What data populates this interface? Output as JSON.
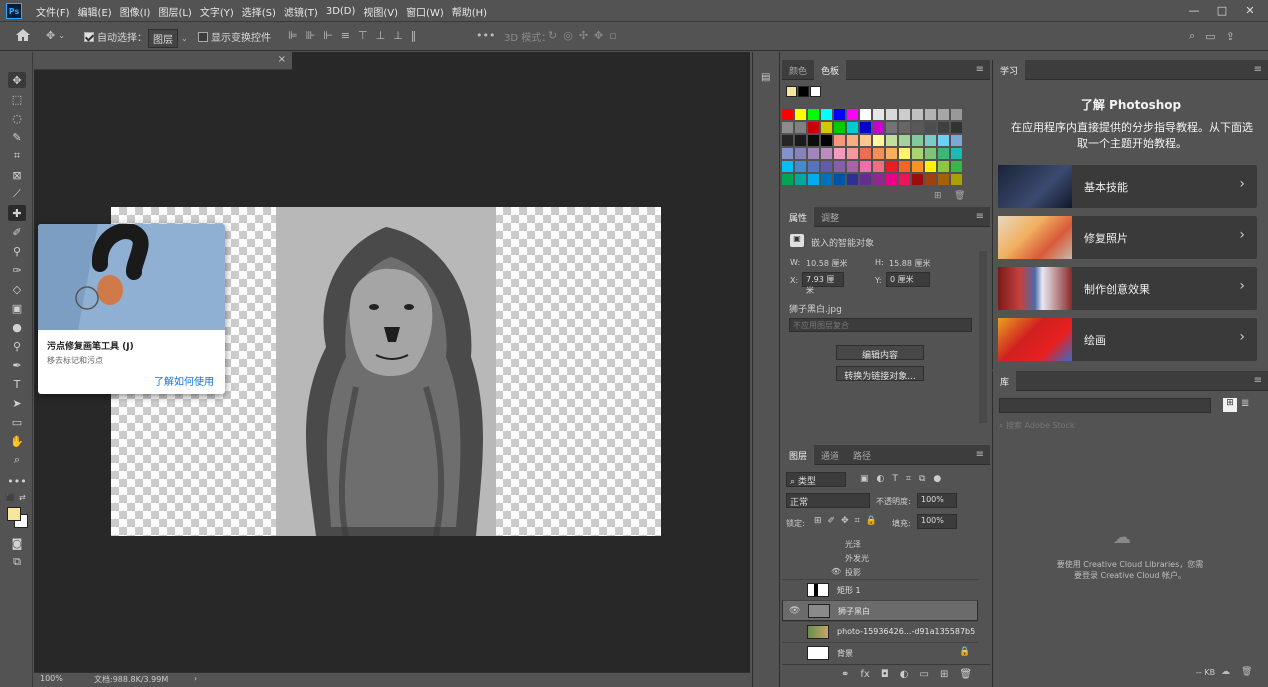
{
  "app": {
    "logo": "Ps"
  },
  "menubar": {
    "items": [
      "文件(F)",
      "编辑(E)",
      "图像(I)",
      "图层(L)",
      "文字(Y)",
      "选择(S)",
      "滤镜(T)",
      "3D(D)",
      "视图(V)",
      "窗口(W)",
      "帮助(H)"
    ],
    "window_controls": [
      "—",
      "□",
      "✕"
    ]
  },
  "options": {
    "auto_select_label": "自动选择：",
    "auto_select_target": "图层",
    "show_transform_label": "显示变换控件",
    "mode_3d_label": "3D 模式："
  },
  "document": {
    "tab_close": "×"
  },
  "tooltip": {
    "title": "污点修复画笔工具 (J)",
    "subtitle": "移去标记和污点",
    "link": "了解如何使用"
  },
  "status": {
    "zoom": "100%",
    "doc_info": "文档:988.8K/3.99M",
    "arrow": "›"
  },
  "swatches": {
    "tabs": [
      "颜色",
      "色板"
    ],
    "active_tab": "色板",
    "recent": [
      "#f6e79a",
      "#000000",
      "#ffffff"
    ],
    "rows": [
      [
        "#ff0000",
        "#ffff00",
        "#00ff00",
        "#00ffff",
        "#0000ff",
        "#ff00ff",
        "#ffffff",
        "#e6e6e6",
        "#d9d9d9",
        "#cccccc",
        "#c0c0c0",
        "#b3b3b3",
        "#a6a6a6",
        "#999999"
      ],
      [
        "#8c8c8c",
        "#808080",
        "#cc0000",
        "#cccc00",
        "#00cc00",
        "#00cccc",
        "#0000cc",
        "#cc00cc",
        "#737373",
        "#666666",
        "#595959",
        "#4d4d4d",
        "#404040",
        "#333333"
      ],
      [
        "#262626",
        "#1a1a1a",
        "#0d0d0d",
        "#000000",
        "#f7977a",
        "#fbad82",
        "#fdc68c",
        "#fff799",
        "#c4df9b",
        "#a3d39c",
        "#82ca9c",
        "#7accc8",
        "#6dcff6",
        "#7da7d9"
      ],
      [
        "#8393ca",
        "#8781bd",
        "#a186be",
        "#bd8cbf",
        "#f49ac1",
        "#f5989d",
        "#f26c4f",
        "#f68e55",
        "#fbaf5c",
        "#fff467",
        "#acd372",
        "#7cc576",
        "#3bb878",
        "#1abbb4"
      ],
      [
        "#00bff3",
        "#438ccb",
        "#5574b9",
        "#605ca8",
        "#855fa8",
        "#a763a8",
        "#f06ea9",
        "#f26d7d",
        "#ed1c24",
        "#f26522",
        "#f7941d",
        "#fff200",
        "#8dc63f",
        "#39b54a"
      ],
      [
        "#00a651",
        "#00a99d",
        "#00aeef",
        "#0072bc",
        "#0054a6",
        "#2e3192",
        "#662d91",
        "#92278f",
        "#ec008c",
        "#ed145b",
        "#9e0b0f",
        "#a0410d",
        "#a36209",
        "#aba000"
      ]
    ]
  },
  "properties": {
    "tabs": [
      "属性",
      "调整"
    ],
    "active_tab": "属性",
    "type_label": "嵌入的智能对象",
    "w_label": "W:",
    "w_value": "10.58 厘米",
    "h_label": "H:",
    "h_value": "15.88 厘米",
    "x_label": "X:",
    "x_value": "7.93 厘米",
    "y_label": "Y:",
    "y_value": "0 厘米",
    "filename": "狮子黑白.jpg",
    "comp_placeholder": "不应用图层复合",
    "edit_button": "编辑内容",
    "convert_button": "转换为链接对象..."
  },
  "layers": {
    "tabs": [
      "图层",
      "通道",
      "路径"
    ],
    "active_tab": "图层",
    "filter_label": "类型",
    "blend_mode": "正常",
    "opacity_label": "不透明度:",
    "opacity_value": "100%",
    "lock_label": "锁定:",
    "fill_label": "填充:",
    "fill_value": "100%",
    "effects": [
      "光泽",
      "外发光",
      "投影"
    ],
    "items": [
      {
        "name": "矩形 1",
        "visible": false,
        "selected": false
      },
      {
        "name": "狮子黑白",
        "visible": true,
        "selected": true
      },
      {
        "name": "photo-15936426...-d91a135587b5",
        "visible": false,
        "selected": false
      },
      {
        "name": "背景",
        "visible": false,
        "selected": false
      }
    ]
  },
  "learn": {
    "tab": "学习",
    "title": "了解 Photoshop",
    "subtitle": "在应用程序内直接提供的分步指导教程。从下面选取一个主题开始教程。",
    "cards": [
      {
        "label": "基本技能"
      },
      {
        "label": "修复照片"
      },
      {
        "label": "制作创意效果"
      },
      {
        "label": "绘画"
      }
    ]
  },
  "library": {
    "tab": "库",
    "search_placeholder": "搜索 Adobe Stock",
    "message": "要使用 Creative Cloud Libraries，您需要登录 Creative Cloud 帐户。",
    "footer_kb": "-- KB"
  }
}
